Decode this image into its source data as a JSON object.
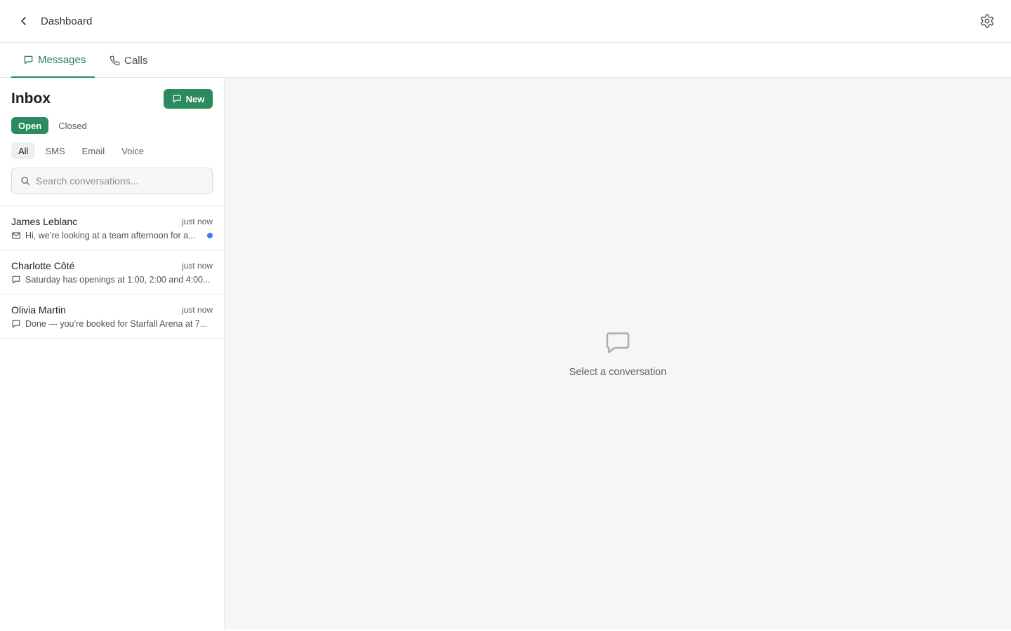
{
  "header": {
    "back_label": "Dashboard",
    "back_icon": "chevron-left-icon",
    "settings_icon": "gear-icon"
  },
  "tabs": [
    {
      "label": "Messages",
      "icon": "message-icon",
      "active": true
    },
    {
      "label": "Calls",
      "icon": "phone-icon",
      "active": false
    }
  ],
  "sidebar": {
    "title": "Inbox",
    "new_button_label": "New",
    "status": {
      "open": "Open",
      "closed": "Closed",
      "selected": "Open"
    },
    "channels": [
      "All",
      "SMS",
      "Email",
      "Voice"
    ],
    "selected_channel": "All",
    "search_placeholder": "Search conversations...",
    "conversations": [
      {
        "name": "James Leblanc",
        "time": "just now",
        "channel_icon": "mail-icon",
        "preview": "Hi, we’re looking at a team afternoon for a...",
        "unread": true
      },
      {
        "name": "Charlotte Côté",
        "time": "just now",
        "channel_icon": "message-icon",
        "preview": "Saturday has openings at 1:00, 2:00 and 4:00...",
        "unread": false
      },
      {
        "name": "Olivia Martin",
        "time": "just now",
        "channel_icon": "message-icon",
        "preview": "Done — you’re booked for Starfall Arena at 7...",
        "unread": false
      }
    ]
  },
  "main": {
    "empty_icon": "message-icon",
    "empty_text": "Select a conversation"
  },
  "colors": {
    "accent": "#2b8a5e",
    "unread_dot": "#3b82f6",
    "main_bg": "#f5f6f5",
    "border": "#e5e7e6"
  }
}
